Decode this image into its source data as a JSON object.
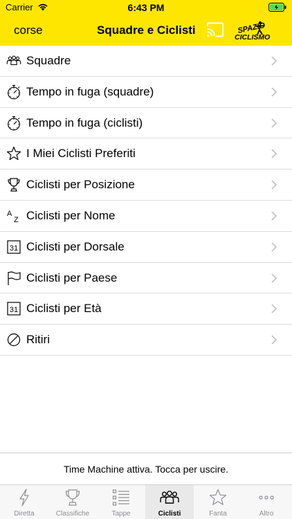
{
  "status_bar": {
    "carrier": "Carrier",
    "time": "6:43 PM"
  },
  "nav": {
    "back_label": "corse",
    "title": "Squadre e Ciclisti",
    "logo_text_top": "SPAZIO",
    "logo_text_bottom": "CICLISMO"
  },
  "colors": {
    "accent": "#ffe600",
    "battery": "#4cd964"
  },
  "menu": [
    {
      "label": "Squadre",
      "icon": "team-icon"
    },
    {
      "label": "Tempo in fuga (squadre)",
      "icon": "stopwatch-icon"
    },
    {
      "label": "Tempo in fuga (ciclisti)",
      "icon": "stopwatch-icon"
    },
    {
      "label": "I Miei Ciclisti Preferiti",
      "icon": "star-icon"
    },
    {
      "label": "Ciclisti per Posizione",
      "icon": "trophy-icon"
    },
    {
      "label": "Ciclisti per Nome",
      "icon": "alphabetical-icon",
      "icon_text_a": "A",
      "icon_text_z": "Z"
    },
    {
      "label": "Ciclisti per Dorsale",
      "icon": "calendar-icon",
      "icon_text": "31"
    },
    {
      "label": "Ciclisti per Paese",
      "icon": "flag-icon"
    },
    {
      "label": "Ciclisti per Età",
      "icon": "calendar-icon",
      "icon_text": "31"
    },
    {
      "label": "Ritiri",
      "icon": "prohibited-icon"
    }
  ],
  "time_machine": {
    "text": "Time Machine attiva. Tocca per uscire."
  },
  "tabs": [
    {
      "label": "Diretta",
      "icon": "lightning-icon",
      "active": false
    },
    {
      "label": "Classifiche",
      "icon": "trophy-icon",
      "active": false
    },
    {
      "label": "Tappe",
      "icon": "list-icon",
      "active": false
    },
    {
      "label": "Ciclisti",
      "icon": "team-icon",
      "active": true
    },
    {
      "label": "Fanta",
      "icon": "star-icon",
      "active": false
    },
    {
      "label": "Altro",
      "icon": "more-icon",
      "active": false
    }
  ]
}
